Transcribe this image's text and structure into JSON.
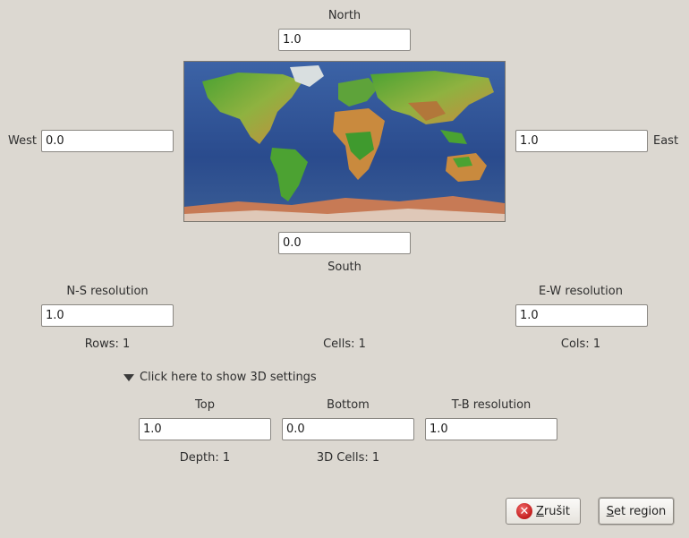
{
  "region": {
    "north_label": "North",
    "north_value": "1.0",
    "south_label": "South",
    "south_value": "0.0",
    "west_label": "West",
    "west_value": "0.0",
    "east_label": "East",
    "east_value": "1.0"
  },
  "resolution": {
    "ns_label": "N-S resolution",
    "ns_value": "1.0",
    "ew_label": "E-W resolution",
    "ew_value": "1.0",
    "rows_text": "Rows: 1",
    "cells_text": "Cells: 1",
    "cols_text": "Cols: 1"
  },
  "settings3d": {
    "expander_label": "Click here to show 3D settings",
    "top_label": "Top",
    "top_value": "1.0",
    "bottom_label": "Bottom",
    "bottom_value": "0.0",
    "tb_label": "T-B resolution",
    "tb_value": "1.0",
    "depth_text": "Depth: 1",
    "cells3d_text": "3D Cells: 1"
  },
  "buttons": {
    "cancel_mnemonic": "Z",
    "cancel_rest": "rušit",
    "set_mnemonic": "S",
    "set_rest": "et region"
  },
  "colors": {
    "background": "#dcd8d1",
    "ocean": "#2b4a8a",
    "land_green": "#3f9a2e",
    "land_brown": "#c98a3e"
  }
}
